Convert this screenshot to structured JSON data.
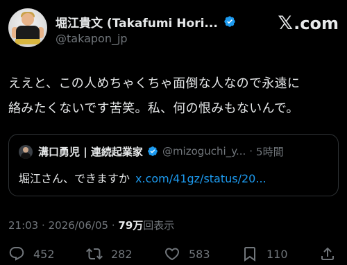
{
  "header": {
    "display_name": "堀江貴文 (Takafumi Hori...",
    "handle": "@takapon_jp",
    "logo_x": "𝕏",
    "logo_suffix": ".com"
  },
  "tweet": {
    "line1": "ええと、この人めちゃくちゃ面倒な人なので永遠に",
    "line2": "絡みたくないです苦笑。私、何の恨みもないんで。"
  },
  "quote": {
    "display_name": "溝口勇児 | 連続起業家",
    "handle": "@mizoguchi_y...",
    "dot": "·",
    "time": "5時間",
    "text": "堀江さん、できますか",
    "link": "x.com/41gz/status/20..."
  },
  "meta": {
    "time": "21:03",
    "sep": "·",
    "date": "2026/06/05",
    "sep2": "·",
    "views_num": "79万",
    "views_label": "回表示"
  },
  "actions": {
    "reply_count": "452",
    "retweet_count": "282",
    "like_count": "583",
    "bookmark_count": "110"
  },
  "colors": {
    "background": "#000000",
    "text": "#e7e9ea",
    "secondary": "#71767b",
    "link": "#1d9bf0",
    "border": "#2f3336"
  }
}
